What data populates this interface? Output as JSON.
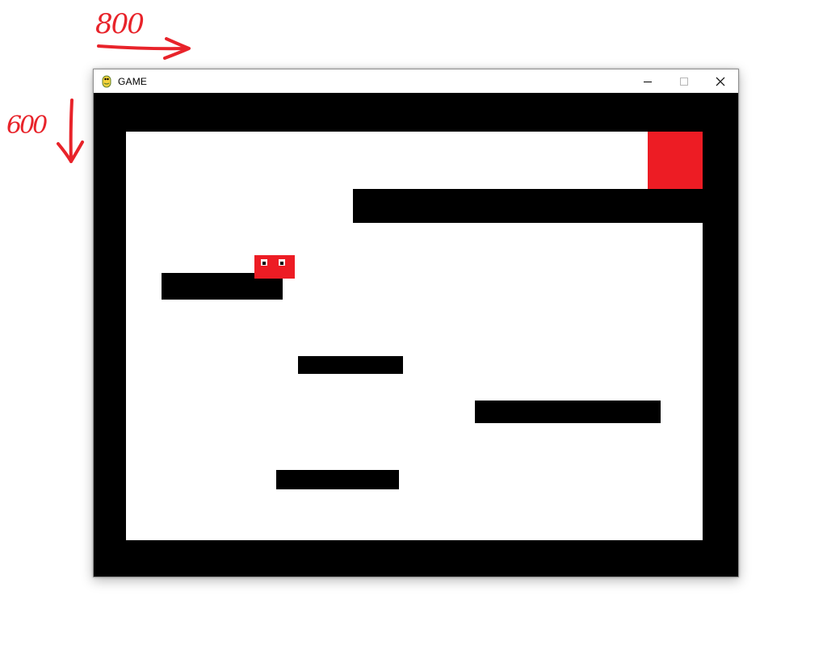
{
  "annotations": {
    "width_label": "800",
    "height_label": "600",
    "color": "#e8232a"
  },
  "window": {
    "title": "GAME",
    "app_icon": "pygame-snake-icon",
    "controls": [
      "minimize-icon",
      "maximize-icon",
      "close-icon"
    ]
  },
  "game": {
    "background_color": "#000000",
    "playfield_color": "#ffffff",
    "goal_color": "#ed1c24",
    "player_color": "#ed1c24"
  }
}
